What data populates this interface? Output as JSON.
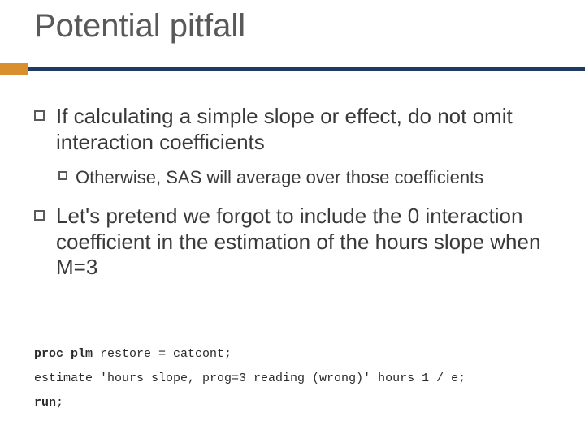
{
  "title": "Potential pitfall",
  "bullets": {
    "b1": "If calculating a simple slope or effect, do not omit interaction coefficients",
    "b1a": "Otherwise, SAS will average over those coefficients",
    "b2": "Let's pretend we forgot to include the 0 interaction coefficient in the estimation of the hours slope when M=3"
  },
  "code": {
    "l1_kw": "proc plm",
    "l1_rest": " restore = catcont;",
    "l2": "estimate 'hours slope, prog=3 reading (wrong)' hours 1 / e;",
    "l3_kw": "run",
    "l3_rest": ";"
  }
}
